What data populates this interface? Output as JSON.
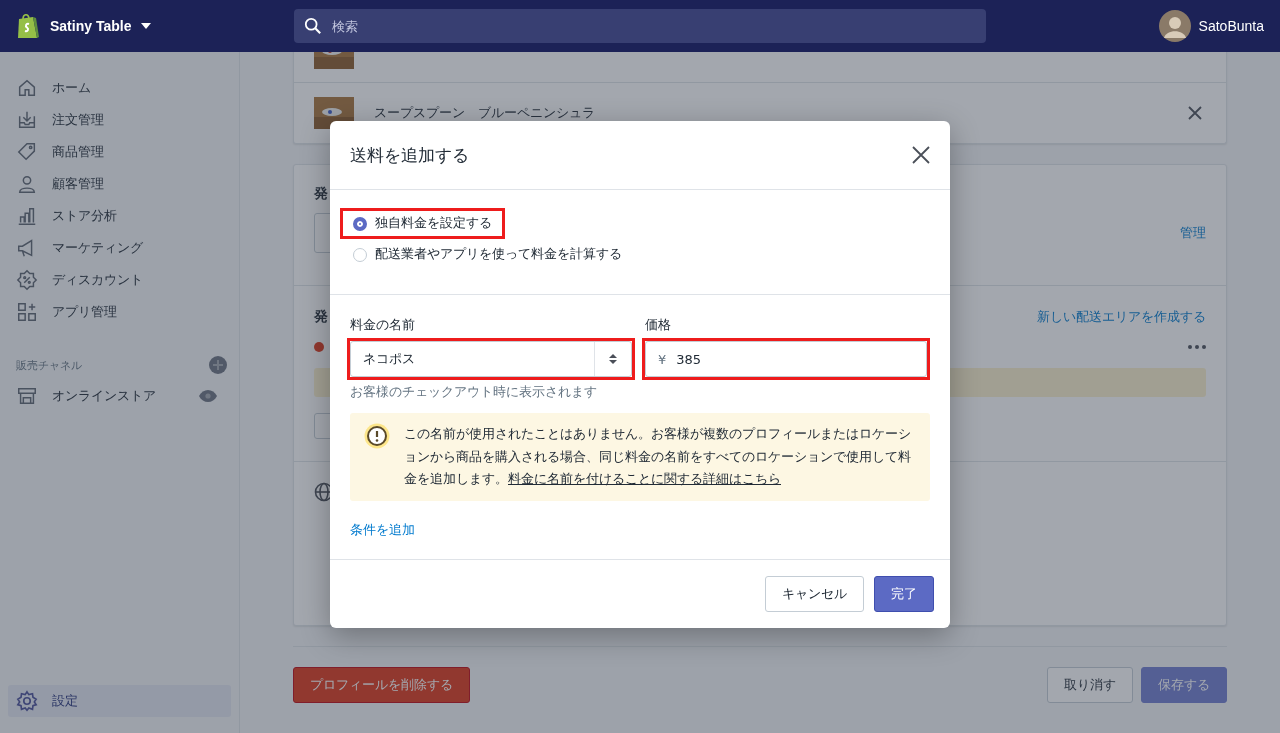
{
  "topbar": {
    "store_name": "Satiny Table",
    "search": {
      "placeholder": "検索"
    },
    "user_name": "SatoBunta"
  },
  "sidebar": {
    "items": [
      {
        "label": "ホーム",
        "selected": false
      },
      {
        "label": "注文管理",
        "selected": false
      },
      {
        "label": "商品管理",
        "selected": false
      },
      {
        "label": "顧客管理",
        "selected": false
      },
      {
        "label": "ストア分析",
        "selected": false
      },
      {
        "label": "マーケティング",
        "selected": false
      },
      {
        "label": "ディスカウント",
        "selected": false
      },
      {
        "label": "アプリ管理",
        "selected": false
      }
    ],
    "channels_heading": "販売チャネル",
    "channels": [
      {
        "label": "オンラインストア",
        "selected": false
      }
    ],
    "settings": {
      "label": "設定",
      "selected": true
    }
  },
  "page": {
    "products": [
      {
        "name": "スープスプーン　ブルーペニンシュラ"
      }
    ],
    "section_1_heading": "発",
    "manage_link": "管理",
    "section_2_heading": "発",
    "create_zone_link": "新しい配送エリアを作成する",
    "delete_button": "プロフィールを削除する",
    "discard_button": "取り消す",
    "save_button": "保存する"
  },
  "dialog": {
    "title": "送料を追加する",
    "rate_options": [
      {
        "label": "独自料金を設定する",
        "selected": true,
        "highlighted": true
      },
      {
        "label": "配送業者やアプリを使って料金を計算する",
        "selected": false,
        "highlighted": false
      }
    ],
    "rate_name": {
      "label": "料金の名前",
      "value": "ネコポス",
      "hint": "お客様のチェックアウト時に表示されます",
      "highlighted": true
    },
    "price": {
      "label": "価格",
      "currency": "¥",
      "value": "385",
      "highlighted": true
    },
    "notice": {
      "text": "この名前が使用されたことはありません。お客様が複数のプロフィールまたはロケーションから商品を購入される場合、同じ料金の名前をすべてのロケーションで使用して料金を追加します。",
      "link": "料金に名前を付けることに関する詳細はこちら"
    },
    "add_condition_link": "条件を追加",
    "cancel_button": "キャンセル",
    "done_button": "完了"
  }
}
